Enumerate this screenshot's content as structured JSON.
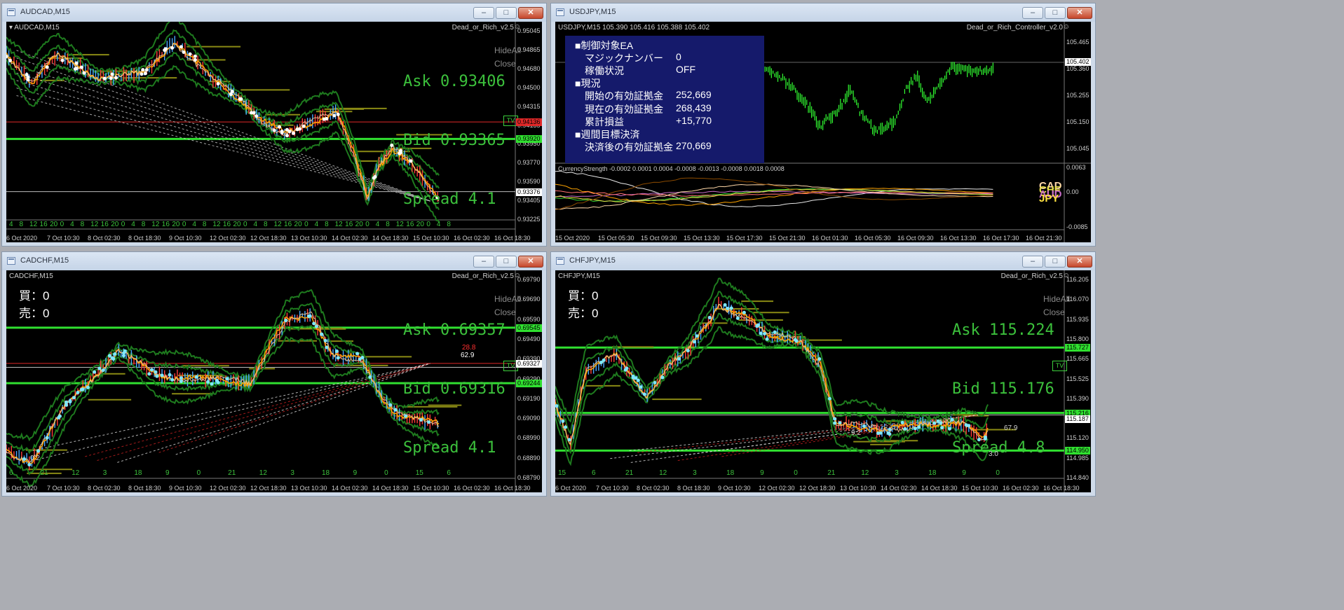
{
  "windows": [
    {
      "id": "audcad",
      "title": "AUDCAD,M15",
      "chart_label": "AUDCAD,M15",
      "ea_name": "Dead_or_Rich_v2.5",
      "ask": "Ask 0.93406",
      "bid": "Bid 0.93365",
      "spread": "Spread 4.1",
      "side_buttons": [
        "HideAll",
        "Close"
      ],
      "tv_badge": "TV",
      "price_axis": [
        "0.95045",
        "0.94865",
        "0.94680",
        "0.94500",
        "0.94315",
        "0.94135",
        "0.93950",
        "0.93770",
        "0.93590",
        "0.93405",
        "0.93225"
      ],
      "price_tags": [
        {
          "text": "0.94136",
          "bg": "#e02828",
          "color": "#000000"
        },
        {
          "text": "0.93920",
          "bg": "#30e030",
          "color": "#000000"
        },
        {
          "text": "0.93376",
          "bg": "#ffffff",
          "color": "#000000"
        }
      ],
      "hours": [
        "4",
        "8",
        "12",
        "16",
        "20",
        "0",
        "4",
        "8",
        "12",
        "16",
        "20",
        "0",
        "4",
        "8",
        "12",
        "16",
        "20",
        "0",
        "4",
        "8",
        "12",
        "16",
        "20",
        "0",
        "4",
        "8",
        "12",
        "16",
        "20",
        "0",
        "4",
        "8",
        "12",
        "16",
        "20",
        "0",
        "4",
        "8",
        "12",
        "16",
        "20",
        "0",
        "4",
        "8"
      ],
      "x_labels": [
        "6 Oct 2020",
        "7 Oct 10:30",
        "8 Oct 02:30",
        "8 Oct 18:30",
        "9 Oct 10:30",
        "12 Oct 02:30",
        "12 Oct 18:30",
        "13 Oct 10:30",
        "14 Oct 02:30",
        "14 Oct 18:30",
        "15 Oct 10:30",
        "16 Oct 02:30",
        "16 Oct 18:30"
      ]
    },
    {
      "id": "usdjpy",
      "title": "USDJPY,M15",
      "chart_label": "USDJPY,M15  105.390 105.416 105.388 105.402",
      "ea_name": "Dead_or_Rich_Controller_v2.0",
      "panel": {
        "rows": [
          {
            "label": "■制御対象EA",
            "value": "",
            "indent": false
          },
          {
            "label": "マジックナンバー",
            "value": "0",
            "indent": true
          },
          {
            "label": "稼働状況",
            "value": "OFF",
            "indent": true
          },
          {
            "label": "■現況",
            "value": "",
            "indent": false
          },
          {
            "label": "開始の有効証拠金",
            "value": "252,669",
            "indent": true
          },
          {
            "label": "現在の有効証拠金",
            "value": "268,439",
            "indent": true
          },
          {
            "label": "累計損益",
            "value": "+15,770",
            "indent": true
          },
          {
            "label": "■週間目標決済",
            "value": "",
            "indent": false
          },
          {
            "label": "決済後の有効証拠金",
            "value": "270,669",
            "indent": true
          }
        ]
      },
      "price_axis": [
        "105.465",
        "105.360",
        "105.255",
        "105.150",
        "105.045"
      ],
      "price_tag": {
        "text": "105.402",
        "bg": "#ffffff",
        "color": "#000000"
      },
      "indicator": {
        "label": "CurrencyStrength -0.0002 0.0001 0.0004 -0.0008 -0.0013 -0.0008 0.0018 0.0008",
        "axis": [
          "0.0063",
          "0.00",
          "-0.0085"
        ],
        "legend": [
          {
            "text": "CAD",
            "color": "#ffd8a8"
          },
          {
            "text": "CHF",
            "color": "#e8e048"
          },
          {
            "text": "AUD",
            "color": "#c86cc8"
          },
          {
            "text": "JPY",
            "color": "#ffe040"
          }
        ]
      },
      "x_labels": [
        "15 Oct 2020",
        "15 Oct 05:30",
        "15 Oct 09:30",
        "15 Oct 13:30",
        "15 Oct 17:30",
        "15 Oct 21:30",
        "16 Oct 01:30",
        "16 Oct 05:30",
        "16 Oct 09:30",
        "16 Oct 13:30",
        "16 Oct 17:30",
        "16 Oct 21:30"
      ]
    },
    {
      "id": "cadchf",
      "title": "CADCHF,M15",
      "chart_label": "CADCHF,M15",
      "ea_name": "Dead_or_Rich_v2.5",
      "buy": "買：0",
      "sell": "売：0",
      "ask": "Ask 0.69357",
      "bid": "Bid 0.69316",
      "spread": "Spread 4.1",
      "side_buttons": [
        "HideAll",
        "Close"
      ],
      "tv_badge": "TV",
      "trade_labels": [
        "0.2",
        "28.8",
        "62.9"
      ],
      "price_axis": [
        "0.69790",
        "0.69690",
        "0.69590",
        "0.69490",
        "0.69390",
        "0.69290",
        "0.69190",
        "0.69090",
        "0.68990",
        "0.68890",
        "0.68790"
      ],
      "price_tags": [
        {
          "text": "0.69545",
          "bg": "#30e030",
          "color": "#000000"
        },
        {
          "text": "0.69327",
          "bg": "#ffffff",
          "color": "#000000"
        },
        {
          "text": "0.69244",
          "bg": "#30e030",
          "color": "#000000"
        }
      ],
      "hours": [
        "6",
        "21",
        "12",
        "3",
        "18",
        "9",
        "0",
        "21",
        "12",
        "3",
        "18",
        "9",
        "0",
        "15",
        "6"
      ],
      "x_labels": [
        "6 Oct 2020",
        "7 Oct 10:30",
        "8 Oct 02:30",
        "8 Oct 18:30",
        "9 Oct 10:30",
        "12 Oct 02:30",
        "12 Oct 18:30",
        "13 Oct 10:30",
        "14 Oct 02:30",
        "14 Oct 18:30",
        "15 Oct 10:30",
        "16 Oct 02:30",
        "16 Oct 18:30"
      ]
    },
    {
      "id": "chfjpy",
      "title": "CHFJPY,M15",
      "chart_label": "CHFJPY,M15",
      "ea_name": "Dead_or_Rich_v2.5",
      "buy": "買：0",
      "sell": "売：0",
      "ask": "Ask 115.224",
      "bid": "Bid 115.176",
      "spread": "Spread 4.8",
      "side_buttons": [
        "HideAll",
        "Close"
      ],
      "tv_badge": "TV",
      "trade_labels": [
        "9.2",
        "3.0",
        "67.9"
      ],
      "price_axis": [
        "116.205",
        "116.070",
        "115.935",
        "115.800",
        "115.665",
        "115.525",
        "115.390",
        "115.255",
        "115.120",
        "114.985",
        "114.840"
      ],
      "price_tags": [
        {
          "text": "115.727",
          "bg": "#30e030",
          "color": "#000000"
        },
        {
          "text": "115.216",
          "bg": "#30e030",
          "color": "#000000"
        },
        {
          "text": "115.187",
          "bg": "#ffffff",
          "color": "#000000"
        },
        {
          "text": "114.950",
          "bg": "#30e030",
          "color": "#000000"
        }
      ],
      "hours": [
        "15",
        "6",
        "21",
        "12",
        "3",
        "18",
        "9",
        "0",
        "21",
        "12",
        "3",
        "18",
        "9",
        "0"
      ],
      "x_labels": [
        "6 Oct 2020",
        "7 Oct 10:30",
        "8 Oct 02:30",
        "8 Oct 18:30",
        "9 Oct 10:30",
        "12 Oct 02:30",
        "12 Oct 18:30",
        "13 Oct 10:30",
        "14 Oct 02:30",
        "14 Oct 18:30",
        "15 Oct 10:30",
        "16 Oct 02:30",
        "16 Oct 18:30"
      ]
    }
  ],
  "colors": {
    "background": "#000000",
    "ask_text": "#3cc13c",
    "ma_orange": "#ffa500",
    "band_green": "#1e7a1e",
    "level_green": "#30e030",
    "level_red": "#e02828",
    "zone_olive": "#8a8a14",
    "panel_blue": "#151a6b"
  },
  "icons": {
    "minimize": "minimize-icon",
    "maximize": "maximize-icon",
    "close": "close-icon",
    "smiley": "smiley-icon",
    "window": "chart-window-icon"
  }
}
